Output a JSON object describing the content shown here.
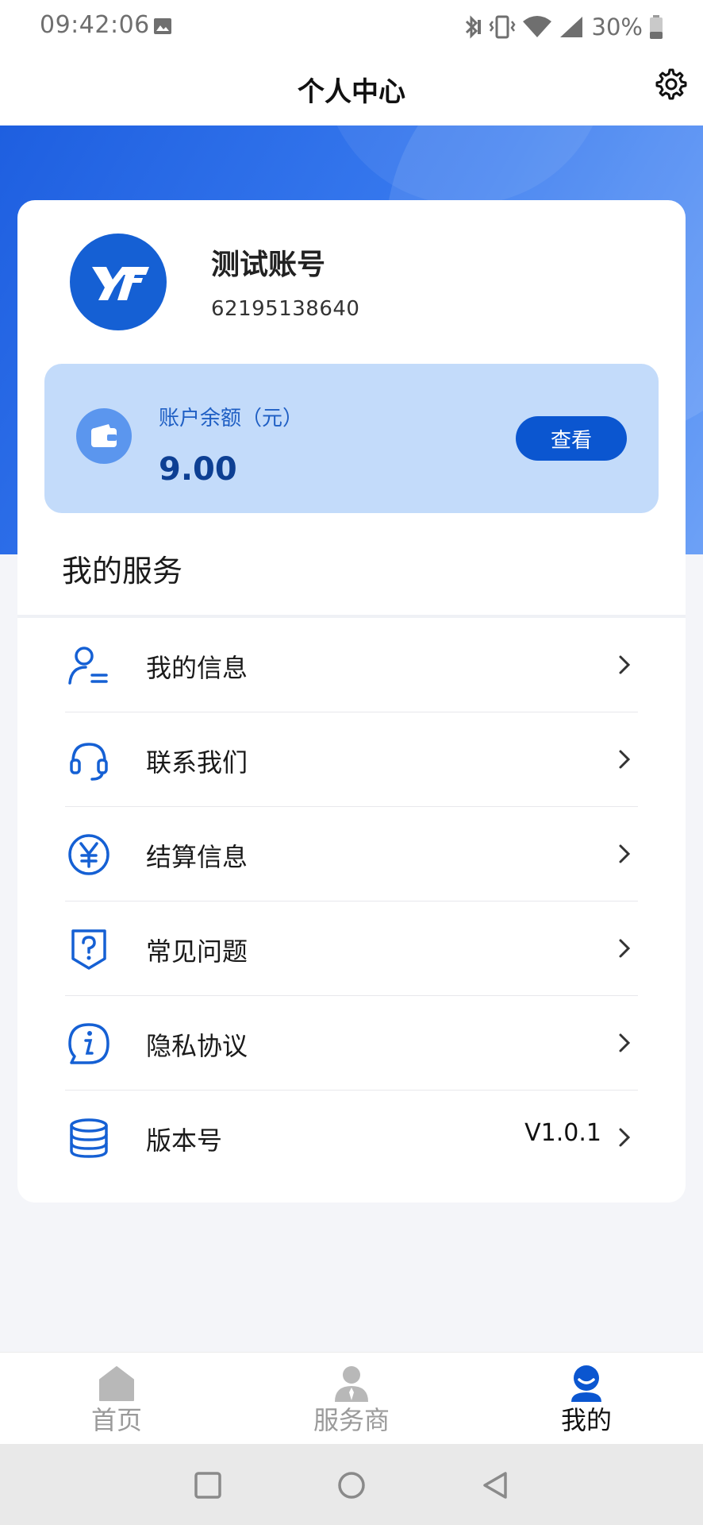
{
  "status_bar": {
    "time": "09:42:06",
    "battery_percent": "30%",
    "icons": [
      "image-notification-icon",
      "bluetooth-icon",
      "vibrate-icon",
      "wifi-icon",
      "signal-icon",
      "battery-icon"
    ]
  },
  "header": {
    "title": "个人中心",
    "settings_icon": "gear-icon"
  },
  "colors": {
    "primary": "#0b56d0",
    "banner_start": "#1e5fe0",
    "balance_bg": "#c3dbfa",
    "balance_text": "#0d3f93"
  },
  "profile": {
    "avatar_logo": "YFT",
    "name": "测试账号",
    "account_id": "62195138640"
  },
  "balance": {
    "label": "账户余额（元）",
    "value": "9.00",
    "button_label": "查看"
  },
  "services": {
    "title": "我的服务",
    "items": [
      {
        "icon": "user-info-icon",
        "label": "我的信息",
        "value": ""
      },
      {
        "icon": "headset-icon",
        "label": "联系我们",
        "value": ""
      },
      {
        "icon": "yen-icon",
        "label": "结算信息",
        "value": ""
      },
      {
        "icon": "question-icon",
        "label": "常见问题",
        "value": ""
      },
      {
        "icon": "info-icon",
        "label": "隐私协议",
        "value": ""
      },
      {
        "icon": "database-icon",
        "label": "版本号",
        "value": "V1.0.1"
      }
    ]
  },
  "tabbar": {
    "tabs": [
      {
        "icon": "home-icon",
        "label": "首页",
        "active": false
      },
      {
        "icon": "provider-icon",
        "label": "服务商",
        "active": false
      },
      {
        "icon": "profile-icon",
        "label": "我的",
        "active": true
      }
    ]
  },
  "navbar": {
    "buttons": [
      "recents-button",
      "home-button",
      "back-button"
    ]
  }
}
